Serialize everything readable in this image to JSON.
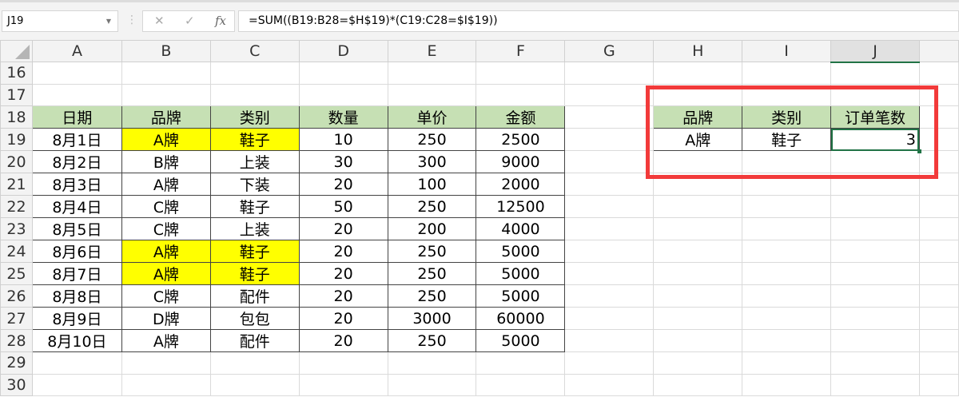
{
  "namebox": "J19",
  "formula": "=SUM((B19:B28=$H$19)*(C19:C28=$I$19))",
  "icons": {
    "cancel": "✕",
    "enter": "✓",
    "fx": "fx"
  },
  "columns": [
    "A",
    "B",
    "C",
    "D",
    "E",
    "F",
    "G",
    "H",
    "I",
    "J",
    ""
  ],
  "selected_column": "J",
  "rows": [
    "16",
    "17",
    "18",
    "19",
    "20",
    "21",
    "22",
    "23",
    "24",
    "25",
    "26",
    "27",
    "28",
    "29",
    "30"
  ],
  "table": {
    "headers": [
      "日期",
      "品牌",
      "类别",
      "数量",
      "单价",
      "金额"
    ],
    "data": [
      [
        "8月1日",
        "A牌",
        "鞋子",
        "10",
        "250",
        "2500"
      ],
      [
        "8月2日",
        "B牌",
        "上装",
        "30",
        "300",
        "9000"
      ],
      [
        "8月3日",
        "A牌",
        "下装",
        "20",
        "100",
        "2000"
      ],
      [
        "8月4日",
        "C牌",
        "鞋子",
        "50",
        "250",
        "12500"
      ],
      [
        "8月5日",
        "C牌",
        "上装",
        "20",
        "200",
        "4000"
      ],
      [
        "8月6日",
        "A牌",
        "鞋子",
        "20",
        "250",
        "5000"
      ],
      [
        "8月7日",
        "A牌",
        "鞋子",
        "20",
        "250",
        "5000"
      ],
      [
        "8月8日",
        "C牌",
        "配件",
        "20",
        "250",
        "5000"
      ],
      [
        "8月9日",
        "D牌",
        "包包",
        "20",
        "3000",
        "60000"
      ],
      [
        "8月10日",
        "A牌",
        "配件",
        "20",
        "250",
        "5000"
      ]
    ],
    "highlight_rows": [
      0,
      5,
      6
    ]
  },
  "lookup": {
    "headers": [
      "品牌",
      "类别",
      "订单笔数"
    ],
    "values": [
      "A牌",
      "鞋子",
      "3"
    ]
  },
  "colors": {
    "header_green": "#c6e0b4",
    "highlight": "#ffff00",
    "annotation_red": "#f23a3a",
    "selection": "#217346"
  }
}
